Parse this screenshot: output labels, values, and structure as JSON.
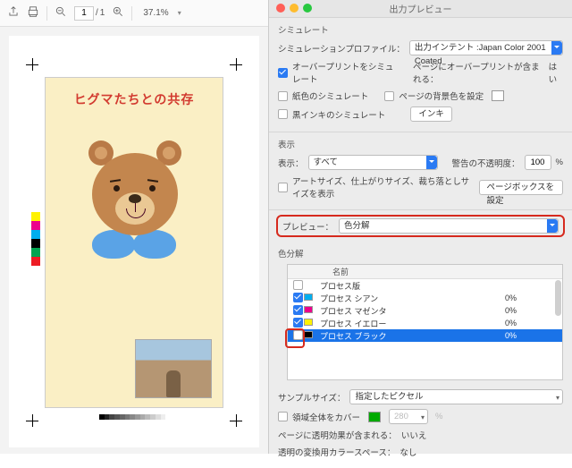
{
  "toolbar": {
    "page_current": "1",
    "page_sep": "/",
    "page_total": "1",
    "zoom": "37.1%"
  },
  "doc": {
    "title": "ヒグマたちとの共存"
  },
  "panel": {
    "title": "出力プレビュー",
    "sim": {
      "heading": "シミュレート",
      "profile_label": "シミュレーションプロファイル：",
      "profile_value": "出力インテント :Japan Color 2001 Coated",
      "overprint_sim": "オーバープリントをシミュレート",
      "overprint_info": "ページにオーバープリントが含まれる：",
      "overprint_val": "はい",
      "paper_sim": "紙色のシミュレート",
      "bg_set": "ページの背景色を設定",
      "black_sim": "黒インキのシミュレート",
      "ink_btn": "インキ"
    },
    "view": {
      "heading": "表示",
      "label": "表示：",
      "value": "すべて",
      "warning_label": "警告の不透明度：",
      "warning_val": "100",
      "warning_unit": "%",
      "artsize": "アートサイズ、仕上がりサイズ、裁ち落としサイズを表示",
      "pagebox_btn": "ページボックスを設定"
    },
    "preview": {
      "label": "プレビュー：",
      "value": "色分解"
    },
    "sep": {
      "heading": "色分解",
      "col_name": "名前",
      "rows": [
        {
          "name": "プロセス版",
          "pct": "",
          "color": "",
          "chk": false,
          "has_swatch": false
        },
        {
          "name": "プロセス シアン",
          "pct": "0%",
          "color": "#00aeef",
          "chk": true,
          "has_swatch": true
        },
        {
          "name": "プロセス マゼンタ",
          "pct": "0%",
          "color": "#ec008c",
          "chk": true,
          "has_swatch": true
        },
        {
          "name": "プロセス イエロー",
          "pct": "0%",
          "color": "#fff200",
          "chk": true,
          "has_swatch": true
        },
        {
          "name": "プロセス ブラック",
          "pct": "0%",
          "color": "#000000",
          "chk": false,
          "has_swatch": true
        }
      ]
    },
    "bottom": {
      "sample_label": "サンプルサイズ：",
      "sample_value": "指定したピクセル",
      "cover_label": "領域全体をカバー",
      "cover_val": "280",
      "cover_unit": "%",
      "transp_label": "ページに透明効果が含まれる：",
      "transp_val": "いいえ",
      "colorspace_label": "透明の変換用カラースペース：",
      "colorspace_val": "なし"
    }
  },
  "colorbar_side": [
    "#fff200",
    "#ec008c",
    "#00aeef",
    "#000000",
    "#00a551",
    "#ed1c24"
  ],
  "colorbar_bottom": [
    "#000",
    "#222",
    "#444",
    "#555",
    "#666",
    "#777",
    "#888",
    "#999",
    "#aaa",
    "#bbb",
    "#ccc",
    "#ddd",
    "#eee",
    "#fff"
  ]
}
